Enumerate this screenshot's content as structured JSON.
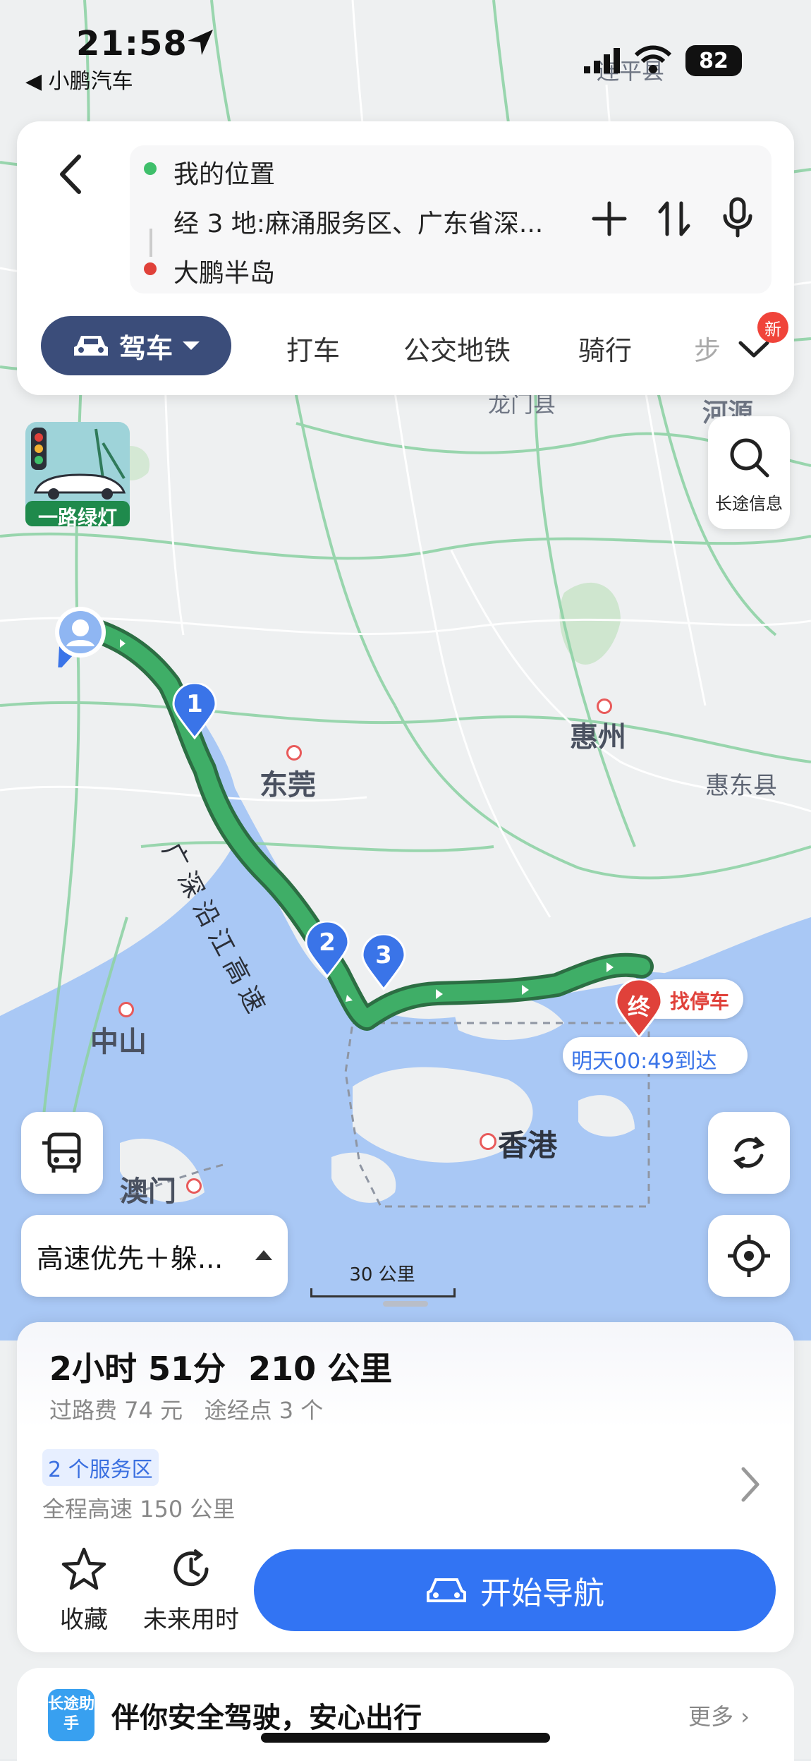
{
  "status_bar": {
    "time": "21:58",
    "back_app": "◀ 小鹏汽车",
    "battery": "82"
  },
  "route": {
    "origin": "我的位置",
    "via": "经 3 地:麻涌服务区、广东省深...",
    "destination": "大鹏半岛"
  },
  "modes": {
    "active": "驾车",
    "items": [
      "打车",
      "公交地铁",
      "骑行",
      "步"
    ],
    "new_badge": "新"
  },
  "map": {
    "places": {
      "dongguan": "东莞",
      "huizhou": "惠州",
      "zhongshan": "中山",
      "macau": "澳门",
      "hongkong": "香港",
      "huidong": "惠东县",
      "longmen": "龙门县",
      "heyuan": "河源",
      "lianping": "连平县"
    },
    "road_label": "广深沿江高速",
    "waypoints": [
      "1",
      "2",
      "3"
    ],
    "end_marker": "终",
    "parking_label": "找停车",
    "arrival": "明天00:49到达",
    "scale": "30 公里",
    "green_light_label": "一路绿灯"
  },
  "side": {
    "long_info": "长途信息",
    "route_pref": "高速优先＋躲..."
  },
  "summary": {
    "duration": "2小时 51分",
    "distance": "210 公里",
    "toll": "过路费 74 元",
    "waypoints": "途经点 3 个",
    "service_areas": "2 个服务区",
    "highway": "全程高速 150 公里"
  },
  "actions": {
    "favorite": "收藏",
    "future_time": "未来用时",
    "start_nav": "开始导航"
  },
  "assistant": {
    "logo": "长途助手",
    "text": "伴你安全驾驶，安心出行",
    "more": "更多"
  },
  "colors": {
    "route": "#3a9a5c",
    "route_dark": "#2c6e43",
    "primary": "#3274f3",
    "header_dark": "#3b4d7a",
    "water": "#a9c8f5"
  }
}
